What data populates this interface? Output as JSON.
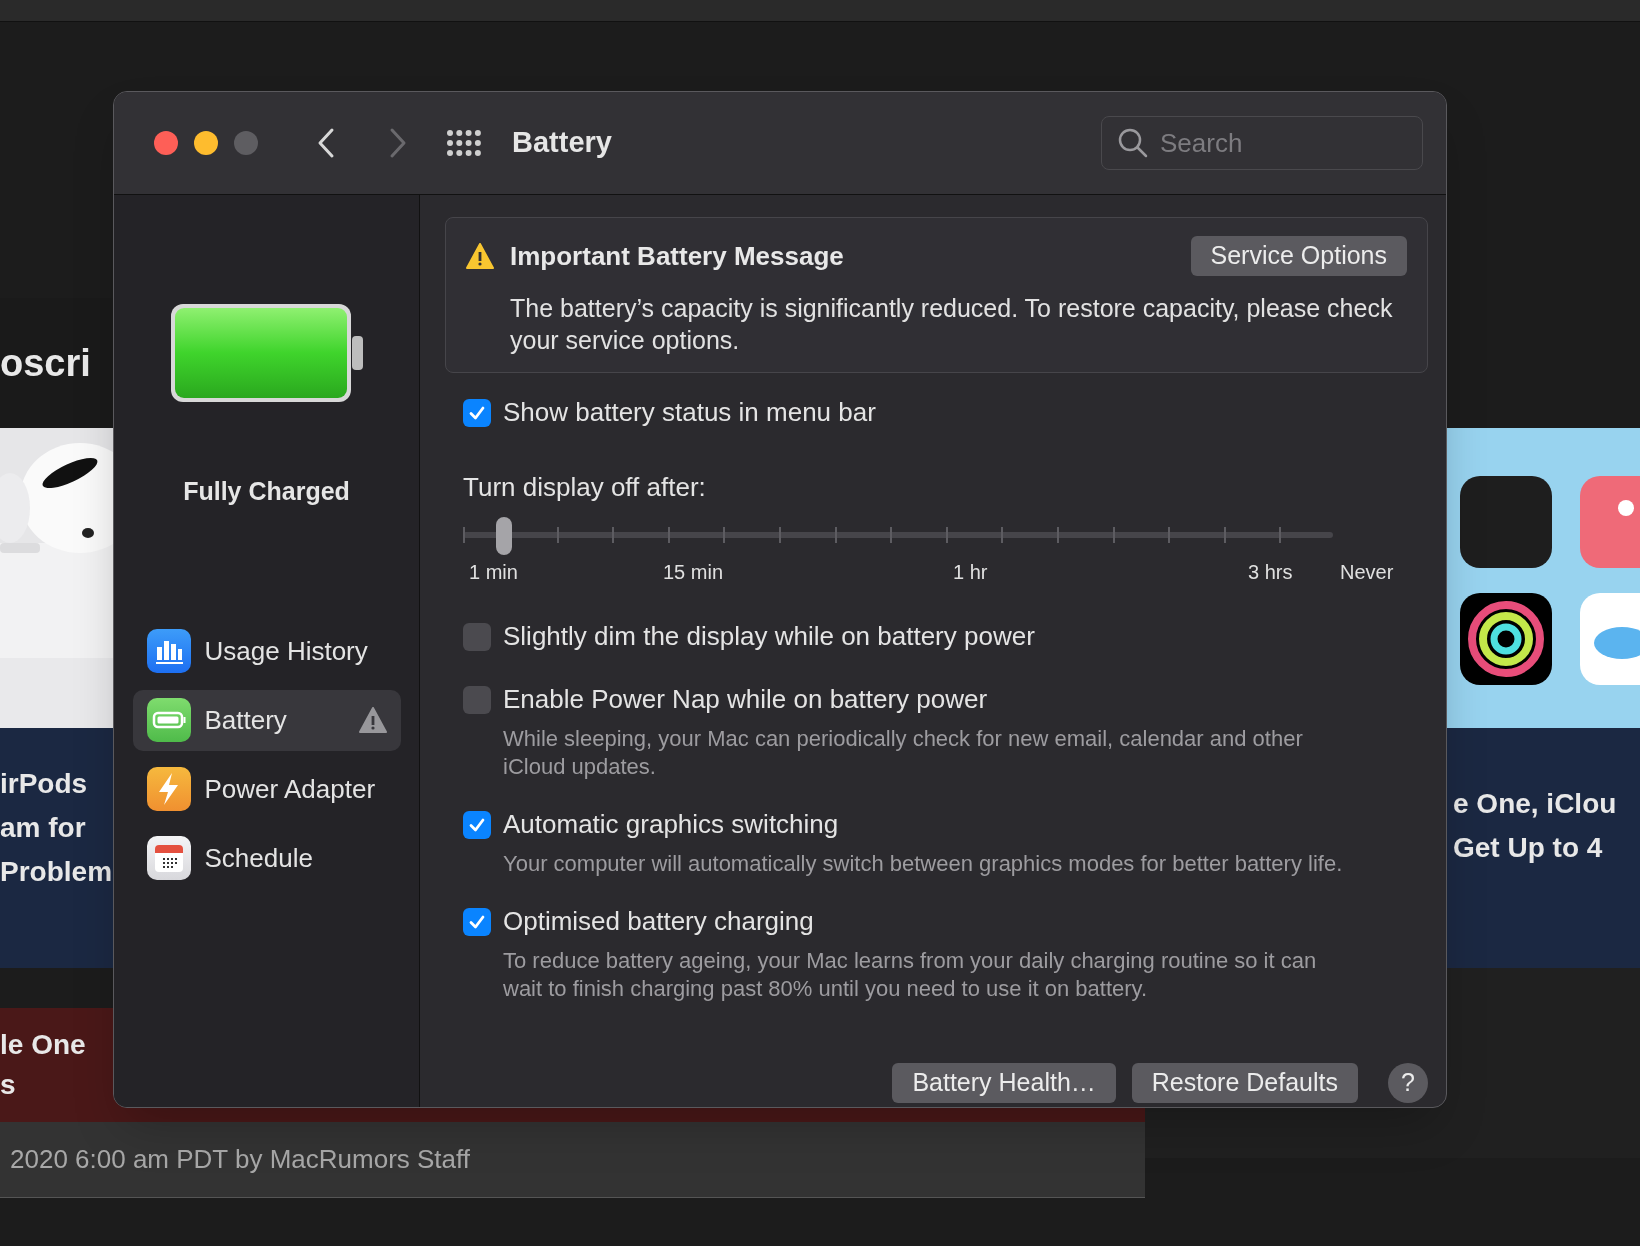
{
  "background": {
    "left_heading": "oscri",
    "left_story": [
      "irPods",
      "am for",
      "Problem"
    ],
    "left_story_2": [
      "le One",
      "s"
    ],
    "right_story": [
      "e One, iClou",
      "Get Up to 4"
    ],
    "byline": "2020 6:00 am PDT by MacRumors Staff"
  },
  "window": {
    "title": "Battery",
    "back_enabled": true,
    "forward_enabled": false,
    "search": {
      "placeholder": "Search"
    }
  },
  "sidebar": {
    "status": "Fully Charged",
    "items": [
      {
        "label": "Usage History",
        "selected": false,
        "warning": false
      },
      {
        "label": "Battery",
        "selected": true,
        "warning": true
      },
      {
        "label": "Power Adapter",
        "selected": false,
        "warning": false
      },
      {
        "label": "Schedule",
        "selected": false,
        "warning": false
      }
    ]
  },
  "message": {
    "title": "Important Battery Message",
    "button": "Service Options",
    "text": "The battery’s capacity is significantly reduced. To restore capacity, please check your service options."
  },
  "options": [
    {
      "kind": "checkbox",
      "label": "Show battery status in menu bar",
      "checked": true
    },
    {
      "kind": "slider",
      "label": "Turn display off after:",
      "level": 0.04,
      "tick_labels": [
        "1 min",
        "15 min",
        "1 hr",
        "3 hrs",
        "Never"
      ]
    },
    {
      "kind": "checkbox",
      "label": "Slightly dim the display while on battery power",
      "checked": false
    },
    {
      "kind": "checkbox",
      "label": "Enable Power Nap while on battery power",
      "checked": false,
      "description": "While sleeping, your Mac can periodically check for new email, calendar and other iCloud updates."
    },
    {
      "kind": "checkbox",
      "label": "Automatic graphics switching",
      "checked": true,
      "description": "Your computer will automatically switch between graphics modes for better battery life."
    },
    {
      "kind": "checkbox",
      "label": "Optimised battery charging",
      "checked": true,
      "description": "To reduce battery ageing, your Mac learns from your daily charging routine so it can wait to finish charging past 80% until you need to use it on battery."
    }
  ],
  "buttons": [
    "Battery Health…",
    "Restore Defaults"
  ],
  "help": "?"
}
